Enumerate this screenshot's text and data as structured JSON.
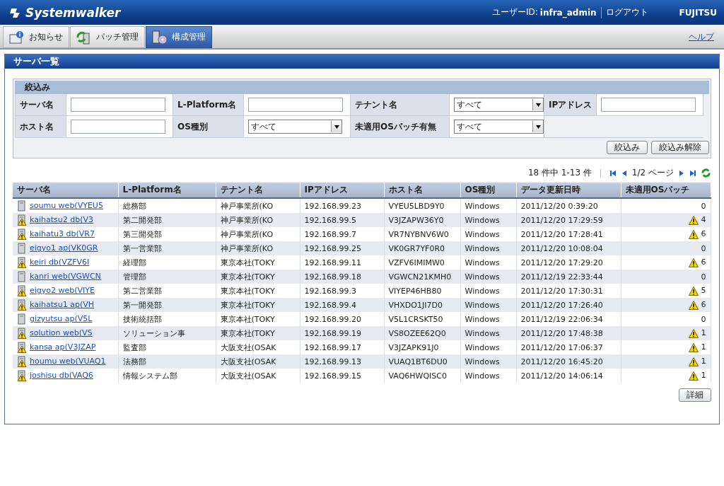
{
  "header": {
    "logo": "Systemwalker",
    "user_label": "ユーザーID:",
    "user_id": "infra_admin",
    "logout": "ログアウト",
    "brand": "FUJITSU"
  },
  "nav_tabs": [
    {
      "label": "お知らせ",
      "selected": false,
      "kind": "info"
    },
    {
      "label": "パッチ管理",
      "selected": false,
      "kind": "patch"
    },
    {
      "label": "構成管理",
      "selected": true,
      "kind": "config"
    }
  ],
  "help": "ヘルプ",
  "panel_title": "サーバ一覧",
  "filter": {
    "title": "絞込み",
    "fields": [
      {
        "label": "サーバ名",
        "kind": "text"
      },
      {
        "label": "L-Platform名",
        "kind": "text"
      },
      {
        "label": "テナント名",
        "kind": "select",
        "value": "すべて"
      },
      {
        "label": "IPアドレス",
        "kind": "text"
      },
      {
        "label": "ホスト名",
        "kind": "text"
      },
      {
        "label": "OS種別",
        "kind": "select",
        "value": "すべて"
      },
      {
        "label": "未適用OSパッチ有無",
        "kind": "select",
        "value": "すべて"
      }
    ],
    "buttons": [
      "絞込み",
      "絞込み解除"
    ]
  },
  "pager": {
    "summary": "18 件中 1-13 件",
    "page": "1/2 ページ"
  },
  "table": {
    "columns": [
      "サーバ名",
      "L-Platform名",
      "テナント名",
      "IPアドレス",
      "ホスト名",
      "OS種別",
      "データ更新日時",
      "未適用OSパッチ"
    ],
    "rows": [
      {
        "server": "soumu web(VYEU5",
        "warning": false,
        "platform": "総務部",
        "tenant": "神戸事業所(KO",
        "ip": "192.168.99.23",
        "host": "VYEU5LBD9Y0",
        "os": "Windows",
        "updated": "2011/12/20 0:39:20",
        "patches": "0"
      },
      {
        "server": "kaihatsu2 db(V3",
        "warning": true,
        "platform": "第二開発部",
        "tenant": "神戸事業所(KO",
        "ip": "192.168.99.5",
        "host": "V3JZAPW36Y0",
        "os": "Windows",
        "updated": "2011/12/20 17:29:59",
        "patches": "4"
      },
      {
        "server": "kaihatu3 db(VR7",
        "warning": true,
        "platform": "第三開発部",
        "tenant": "神戸事業所(KO",
        "ip": "192.168.99.7",
        "host": "VR7NYBNV6W0",
        "os": "Windows",
        "updated": "2011/12/20 17:28:41",
        "patches": "6"
      },
      {
        "server": "eigyo1 ap(VK0GR",
        "warning": false,
        "platform": "第一営業部",
        "tenant": "神戸事業所(KO",
        "ip": "192.168.99.25",
        "host": "VK0GR7YF0R0",
        "os": "Windows",
        "updated": "2011/12/20 10:08:04",
        "patches": "0"
      },
      {
        "server": "keiri db(VZFV6I",
        "warning": true,
        "platform": "経理部",
        "tenant": "東京本社(TOKY",
        "ip": "192.168.99.11",
        "host": "VZFV6IMIMW0",
        "os": "Windows",
        "updated": "2011/12/20 17:29:20",
        "patches": "6"
      },
      {
        "server": "kanri web(VGWCN",
        "warning": false,
        "platform": "管理部",
        "tenant": "東京本社(TOKY",
        "ip": "192.168.99.18",
        "host": "VGWCN21KMH0",
        "os": "Windows",
        "updated": "2011/12/19 22:33:44",
        "patches": "0"
      },
      {
        "server": "eigyo2 web(VIYE",
        "warning": true,
        "platform": "第二営業部",
        "tenant": "東京本社(TOKY",
        "ip": "192.168.99.3",
        "host": "VIYEP46HB80",
        "os": "Windows",
        "updated": "2011/12/20 17:30:31",
        "patches": "5"
      },
      {
        "server": "kaihatsu1 ap(VH",
        "warning": true,
        "platform": "第一開発部",
        "tenant": "東京本社(TOKY",
        "ip": "192.168.99.4",
        "host": "VHXDO1JI7D0",
        "os": "Windows",
        "updated": "2011/12/20 17:26:40",
        "patches": "6"
      },
      {
        "server": "gizyutsu ap(V5L",
        "warning": false,
        "platform": "技術統括部",
        "tenant": "東京本社(TOKY",
        "ip": "192.168.99.20",
        "host": "V5L1CRSKT50",
        "os": "Windows",
        "updated": "2011/12/19 22:06:34",
        "patches": "0"
      },
      {
        "server": "solution web(VS",
        "warning": true,
        "platform": "ソリューション事",
        "tenant": "東京本社(TOKY",
        "ip": "192.168.99.19",
        "host": "VS8OZEE62Q0",
        "os": "Windows",
        "updated": "2011/12/20 17:48:38",
        "patches": "1"
      },
      {
        "server": "kansa ap(V3JZAP",
        "warning": true,
        "platform": "監査部",
        "tenant": "大阪支社(OSAK",
        "ip": "192.168.99.17",
        "host": "V3JZAPK91J0",
        "os": "Windows",
        "updated": "2011/12/20 17:06:37",
        "patches": "1"
      },
      {
        "server": "houmu web(VUAQ1",
        "warning": true,
        "platform": "法務部",
        "tenant": "大阪支社(OSAK",
        "ip": "192.168.99.13",
        "host": "VUAQ1BT6DU0",
        "os": "Windows",
        "updated": "2011/12/20 16:45:20",
        "patches": "1"
      },
      {
        "server": "joshisu db(VAQ6",
        "warning": true,
        "platform": "情報システム部",
        "tenant": "大阪支社(OSAK",
        "ip": "192.168.99.15",
        "host": "VAQ6HWQISC0",
        "os": "Windows",
        "updated": "2011/12/20 14:06:14",
        "patches": "1"
      }
    ]
  },
  "detail_button": "詳細"
}
